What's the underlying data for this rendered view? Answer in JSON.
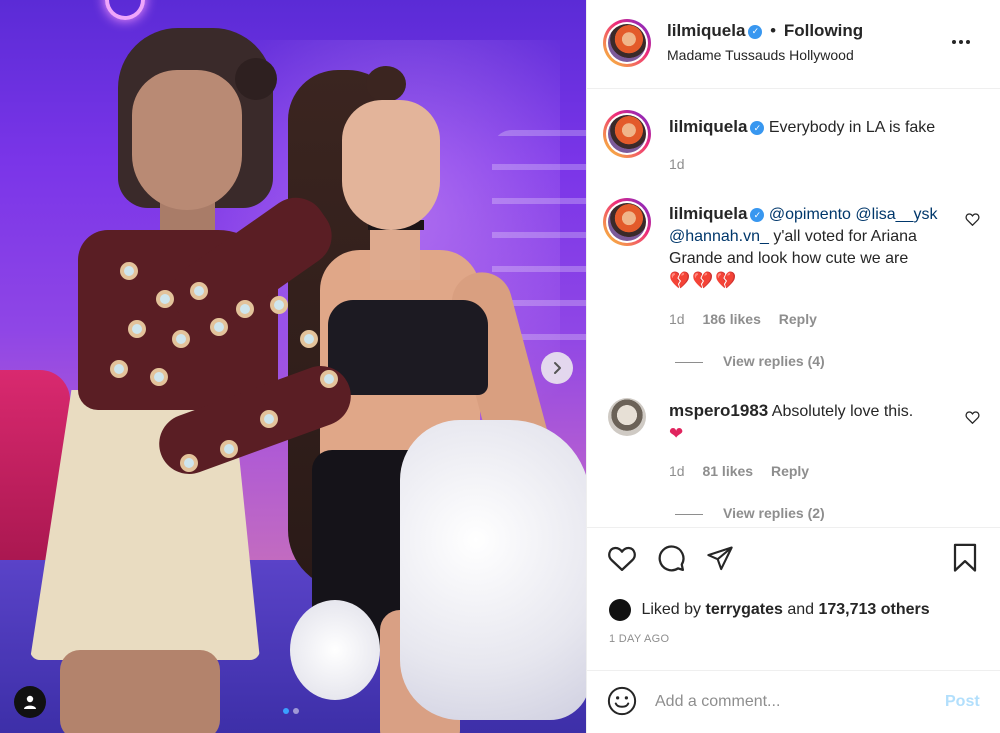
{
  "post": {
    "username": "lilmiquela",
    "separator": "•",
    "follow_status": "Following",
    "location": "Madame Tussauds Hollywood",
    "more_icon": "more-horizontal-icon",
    "verified_icon": "verified-badge-icon"
  },
  "comments": [
    {
      "username": "lilmiquela",
      "text": "Everybody in LA is fake",
      "time": "1d"
    },
    {
      "username": "lilmiquela",
      "mention1": "@opimento",
      "mention2": "@lisa__ysk",
      "mention3": "@hannah.vn_",
      "text": " y'all voted for Ariana Grande and look how cute we are",
      "hearts": "💔💔💔",
      "time": "1d",
      "likes": "186 likes",
      "reply": "Reply",
      "view_replies": "View replies (4)"
    },
    {
      "username": "mspero1983",
      "text": "Absolutely love this.",
      "hearts": "❤",
      "time": "1d",
      "likes": "81 likes",
      "reply": "Reply",
      "view_replies": "View replies (2)"
    }
  ],
  "actions": {
    "like_icon": "heart-outline-icon",
    "comment_icon": "comment-icon",
    "share_icon": "share-icon",
    "save_icon": "bookmark-icon"
  },
  "likes": {
    "prefix": "Liked by",
    "user": "terrygates",
    "conj": "and",
    "others": "173,713 others"
  },
  "time_ago": "1 DAY AGO",
  "add_comment": {
    "placeholder": "Add a comment...",
    "post_label": "Post",
    "emoji_icon": "emoji-icon"
  },
  "carousel": {
    "next_icon": "chevron-right-icon",
    "current": 1,
    "total": 2
  },
  "colors": {
    "link": "#00376b",
    "verified": "#3897f0",
    "post_disabled": "#b2dffc",
    "muted": "#8e8e8e"
  }
}
